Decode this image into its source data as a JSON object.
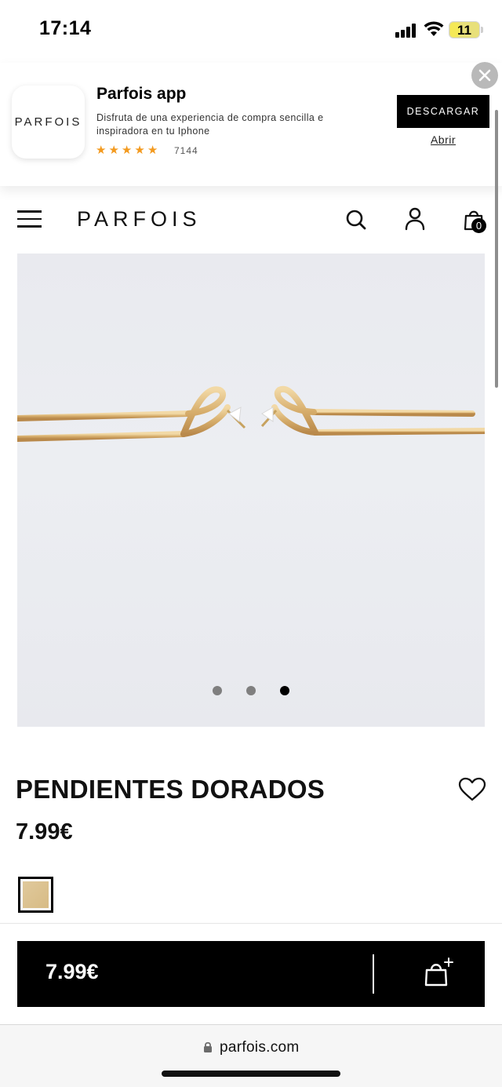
{
  "status_bar": {
    "time": "17:14",
    "battery_level": "11"
  },
  "app_banner": {
    "icon_logo": "PARFOIS",
    "app_name": "Parfois app",
    "description": "Disfruta de una experiencia de compra sencilla e inspiradora en tu Iphone",
    "rating_stars": 5,
    "rating_count": "7144",
    "download_label": "DESCARGAR",
    "open_label": "Abrir",
    "close_icon": "close-icon"
  },
  "header": {
    "logo": "PARFOIS",
    "menu_icon": "hamburger-icon",
    "search_icon": "search-icon",
    "account_icon": "user-icon",
    "bag_icon": "shopping-bag-icon",
    "bag_count": "0"
  },
  "gallery": {
    "image_alt": "gold earrings",
    "slide_count": 3,
    "active_slide": 3
  },
  "product": {
    "title": "PENDIENTES DORADOS",
    "price": "7.99€",
    "color_swatch": "#dcc391",
    "wishlist_icon": "heart-icon"
  },
  "cart_bar": {
    "price": "7.99€",
    "add_icon": "add-to-bag-icon"
  },
  "browser": {
    "url": "parfois.com",
    "lock_icon": "lock-icon"
  },
  "colors": {
    "accent": "#000000",
    "star": "#f39a1f",
    "image_bg": "#eaebef"
  }
}
